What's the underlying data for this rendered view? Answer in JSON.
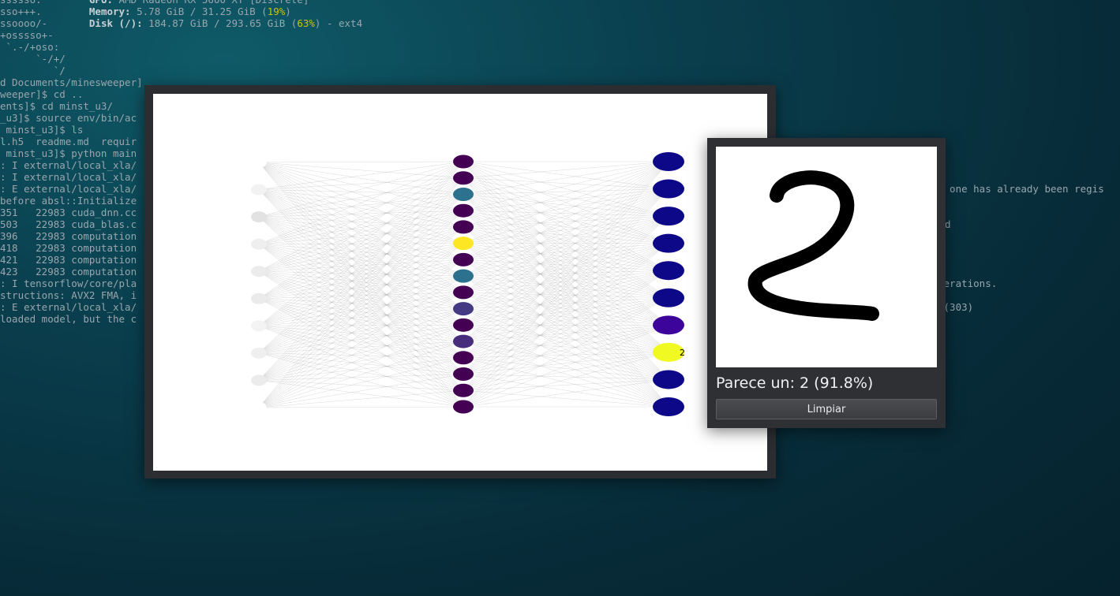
{
  "terminal": {
    "lines": [
      {
        "left": "ssssso.",
        "label": "GPU:",
        "value": " AMD Radeon RX 5600 XT [Discrete]"
      },
      {
        "left": "sso+++.",
        "label": "Memory:",
        "value": " 5.78 GiB / 31.25 GiB (",
        "hl": "19%",
        "tail": ")"
      },
      {
        "left": "ssoooo/-",
        "label": "Disk (/):",
        "value": " 184.87 GiB / 293.65 GiB (",
        "hl": "63%",
        "tail": ") - ext4"
      },
      {
        "left": "+osssso+-"
      },
      {
        "left": " `.-/+oso:"
      },
      {
        "left": "      `-/+/"
      },
      {
        "left": "         `/"
      },
      {
        "left": "d Documents/minesweeper]"
      },
      {
        "left": "weeper]$ cd .."
      },
      {
        "left": "ents]$ cd minst_u3/"
      },
      {
        "left": "_u3]$ source env/bin/ac"
      },
      {
        "left": " minst_u3]$ ls"
      },
      {
        "left": "l.h5  readme.md  requir"
      },
      {
        "left": " minst_u3]$ python main"
      },
      {
        "left": ": I external/local_xla/"
      },
      {
        "left": ": I external/local_xla/"
      },
      {
        "left": ": E external/local_xla/"
      },
      {
        "left": "before absl::Initialize"
      },
      {
        "left": "351   22983 cuda_dnn.cc"
      },
      {
        "left": "503   22983 cuda_blas.c"
      },
      {
        "left": "396   22983 computation"
      },
      {
        "left": "418   22983 computation"
      },
      {
        "left": "421   22983 computation"
      },
      {
        "left": "423   22983 computation"
      },
      {
        "left": ": I tensorflow/core/pla"
      },
      {
        "left": "structions: AVX2 FMA, i"
      },
      {
        "left": ": E external/local_xla/"
      },
      {
        "left": "loaded model, but the c"
      }
    ],
    "right_fragments": [
      {
        "row": 16,
        "text": "n one has already been regis"
      },
      {
        "row": 19,
        "text": "d"
      },
      {
        "row": 24,
        "text": "perations."
      },
      {
        "row": 26,
        "text": " (303)"
      }
    ]
  },
  "network": {
    "input_shades": [
      "#ffffff",
      "#f2f2f2",
      "#e2e2e2",
      "#efefef",
      "#ececec",
      "#ebebeb",
      "#f3f3f3",
      "#efefef",
      "#ebebeb",
      "#ffffff"
    ],
    "hidden_colors": [
      "#440154",
      "#440154",
      "#2c728e",
      "#440154",
      "#440154",
      "#fde725",
      "#440154",
      "#2c728e",
      "#440154",
      "#443983",
      "#440154",
      "#472d7b",
      "#440154",
      "#440154",
      "#440154",
      "#440154"
    ],
    "output_colors": [
      "#0d0887",
      "#0d0887",
      "#0d0887",
      "#0d0887",
      "#0d0887",
      "#0d0887",
      "#3d049b",
      "#f0f921",
      "#0d0887",
      "#0d0887"
    ],
    "output_label": "2",
    "output_label_index": 7
  },
  "drawing": {
    "digit": "2",
    "prediction": "Parece un: 2 (91.8%)",
    "clear_label": "Limpiar"
  }
}
